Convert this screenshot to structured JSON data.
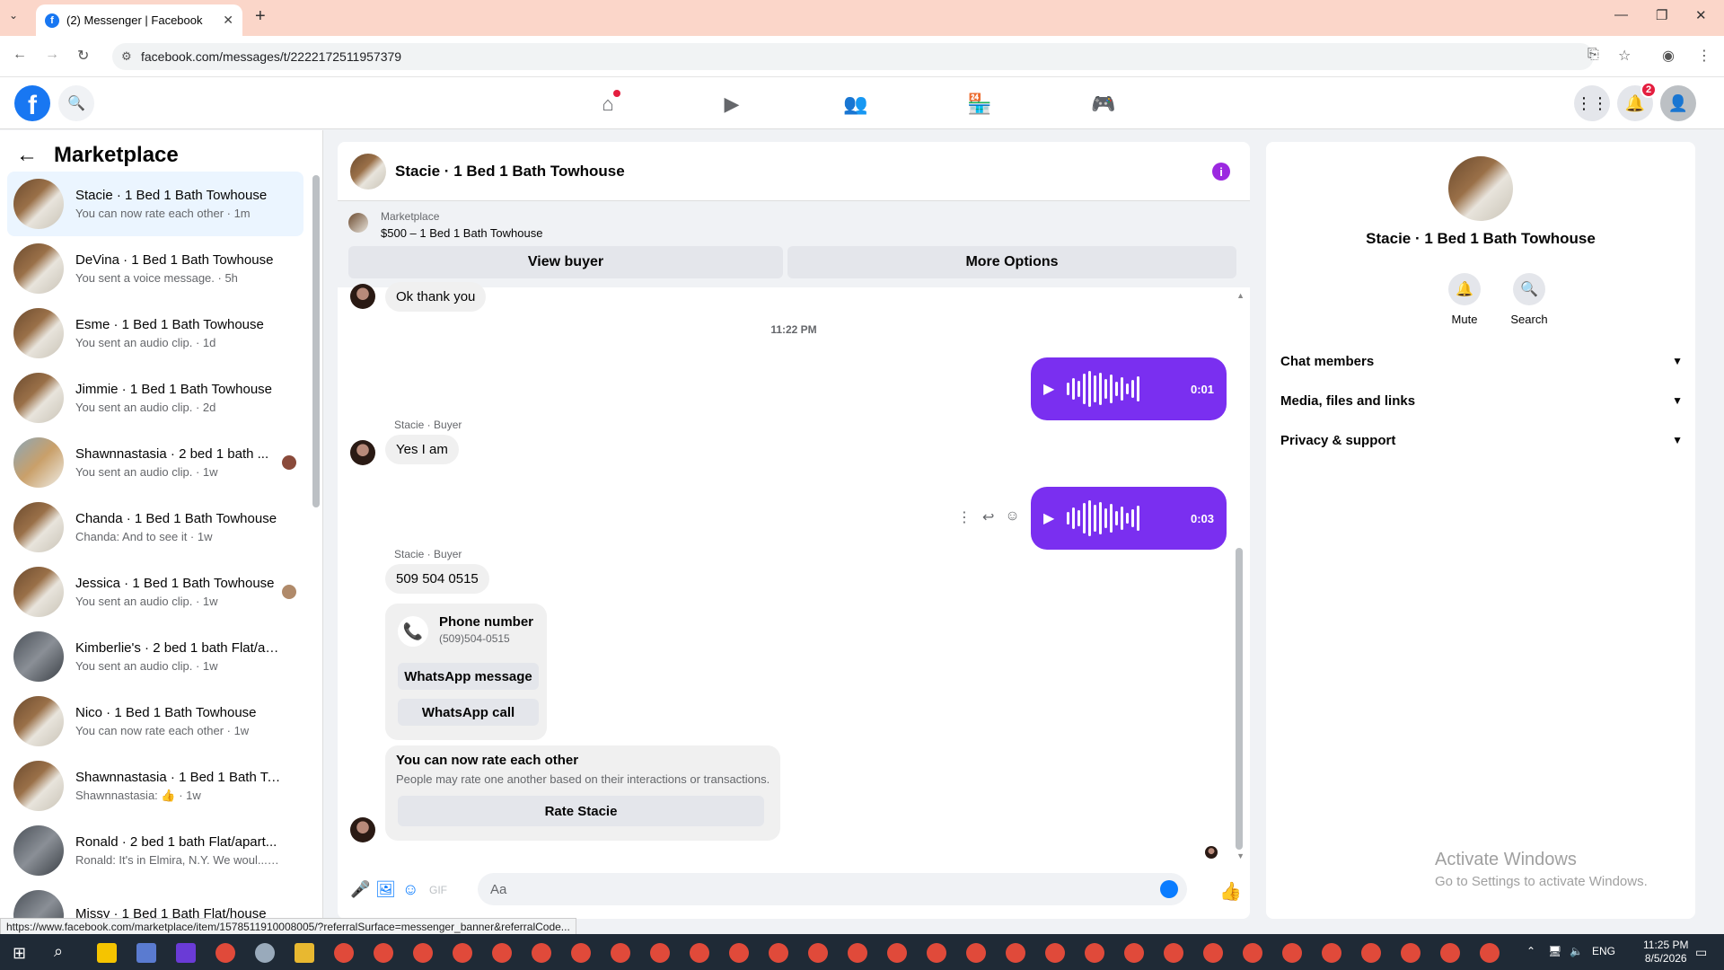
{
  "browser": {
    "tab_title": "(2) Messenger | Facebook",
    "url": "facebook.com/messages/t/2222172511957379",
    "status_url": "https://www.facebook.com/marketplace/item/1578511910008005/?referralSurface=messenger_banner&referralCode..."
  },
  "fbnav": {
    "notifications_count": "2",
    "icons": [
      "home-icon",
      "video-icon",
      "groups-icon",
      "marketplace-icon",
      "gaming-icon"
    ]
  },
  "sidebar": {
    "title": "Marketplace",
    "conversations": [
      {
        "name": "Stacie · 1 Bed 1 Bath Towhouse",
        "sub": "You can now rate each other · 1m"
      },
      {
        "name": "DeVina · 1 Bed 1 Bath Towhouse",
        "sub": "You sent a voice message. · 5h"
      },
      {
        "name": "Esme · 1 Bed 1 Bath Towhouse",
        "sub": "You sent an audio clip. · 1d"
      },
      {
        "name": "Jimmie · 1 Bed 1 Bath Towhouse",
        "sub": "You sent an audio clip. · 2d"
      },
      {
        "name": "Shawnnastasia · 2 bed 1 bath ...",
        "sub": "You sent an audio clip. · 1w"
      },
      {
        "name": "Chanda · 1 Bed 1 Bath Towhouse",
        "sub": "Chanda: And to see it · 1w"
      },
      {
        "name": "Jessica · 1 Bed 1 Bath Towhouse",
        "sub": "You sent an audio clip. · 1w"
      },
      {
        "name": "Kimberlie's · 2 bed 1 bath Flat/ap...",
        "sub": "You sent an audio clip. · 1w"
      },
      {
        "name": "Nico · 1 Bed 1 Bath Towhouse",
        "sub": "You can now rate each other · 1w"
      },
      {
        "name": "Shawnnastasia · 1 Bed 1 Bath To...",
        "sub": "Shawnnastasia: 👍 · 1w"
      },
      {
        "name": "Ronald · 2 bed 1 bath Flat/apart...",
        "sub": "Ronald: It's in Elmira, N.Y. We woul... · 1w"
      },
      {
        "name": "Missy · 1 Bed 1 Bath Flat/house",
        "sub": ""
      }
    ]
  },
  "chat": {
    "title": "Stacie · 1 Bed 1 Bath Towhouse",
    "marketplace_label": "Marketplace",
    "listing": "$500 – 1 Bed 1 Bath Towhouse",
    "view_buyer": "View buyer",
    "more_options": "More Options",
    "msg_ok": "Ok thank you",
    "timestamp": "11:22 PM",
    "audio1_duration": "0:01",
    "sender1": "Stacie · Buyer",
    "msg_yes": "Yes I am",
    "audio2_duration": "0:03",
    "sender2": "Stacie · Buyer",
    "msg_phone": "509 504 0515",
    "phone_title": "Phone number",
    "phone_value": "(509)504-0515",
    "whatsapp_message": "WhatsApp message",
    "whatsapp_call": "WhatsApp call",
    "rate_title": "You can now rate each other",
    "rate_sub": "People may rate one another based on their interactions or transactions.",
    "rate_button": "Rate Stacie",
    "composer_placeholder": "Aa"
  },
  "info": {
    "name": "Stacie · 1 Bed 1 Bath Towhouse",
    "mute": "Mute",
    "search": "Search",
    "sections": [
      "Chat members",
      "Media, files and links",
      "Privacy & support"
    ]
  },
  "watermark": {
    "line1": "Activate Windows",
    "line2": "Go to Settings to activate Windows."
  },
  "taskbar": {
    "lang": "ENG",
    "time": "11:25 PM",
    "date": "8/5/2026"
  },
  "colors": {
    "accent": "#0a7cff",
    "audio_bubble": "#7a2ff0",
    "fb_blue": "#1877f2"
  }
}
